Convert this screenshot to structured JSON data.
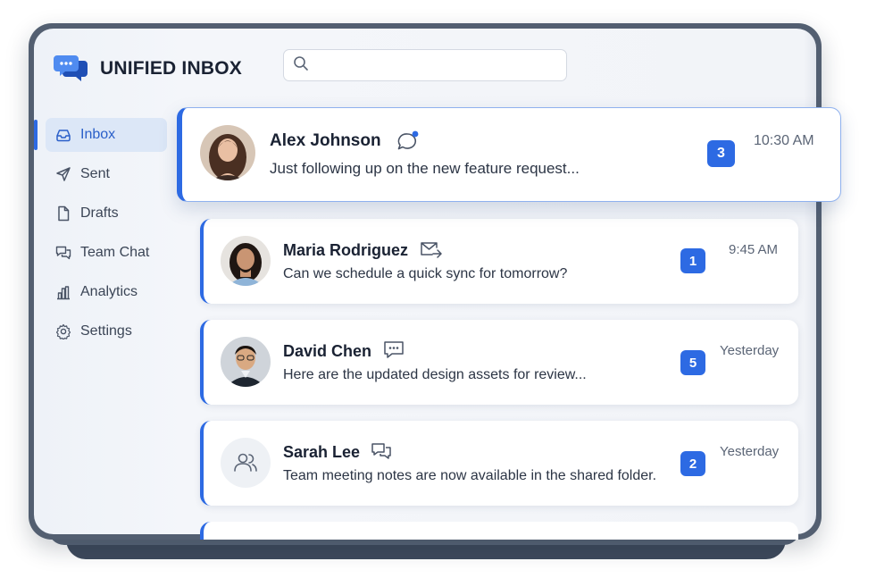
{
  "app": {
    "title": "UNIFIED INBOX",
    "logo_icon": "chat-bubbles-logo",
    "accent": "#2d6ae3"
  },
  "search": {
    "placeholder": "",
    "value": ""
  },
  "sidebar": {
    "items": [
      {
        "label": "Inbox",
        "icon": "inbox-icon",
        "active": true
      },
      {
        "label": "Sent",
        "icon": "send-icon",
        "active": false
      },
      {
        "label": "Drafts",
        "icon": "document-icon",
        "active": false
      },
      {
        "label": "Team Chat",
        "icon": "chat-icon",
        "active": false
      },
      {
        "label": "Analytics",
        "icon": "bar-chart-icon",
        "active": false
      },
      {
        "label": "Settings",
        "icon": "gear-icon",
        "active": false
      }
    ]
  },
  "messages": [
    {
      "name": "Alex Johnson",
      "preview": "Just following up on the new feature request...",
      "time": "10:30 AM",
      "count": "3",
      "channel_icon": "chat-bubble-unread-icon"
    },
    {
      "name": "Maria Rodriguez",
      "preview": "Can we schedule a quick sync for tomorrow?",
      "time": "9:45 AM",
      "count": "1",
      "channel_icon": "email-forward-icon"
    },
    {
      "name": "David Chen",
      "preview": "Here are the updated design assets for review...",
      "time": "Yesterday",
      "count": "5",
      "channel_icon": "message-dots-icon"
    },
    {
      "name": "Sarah Lee",
      "preview": "Team meeting notes are now available in the shared folder.",
      "time": "Yesterday",
      "count": "2",
      "channel_icon": "group-chat-icon"
    }
  ]
}
